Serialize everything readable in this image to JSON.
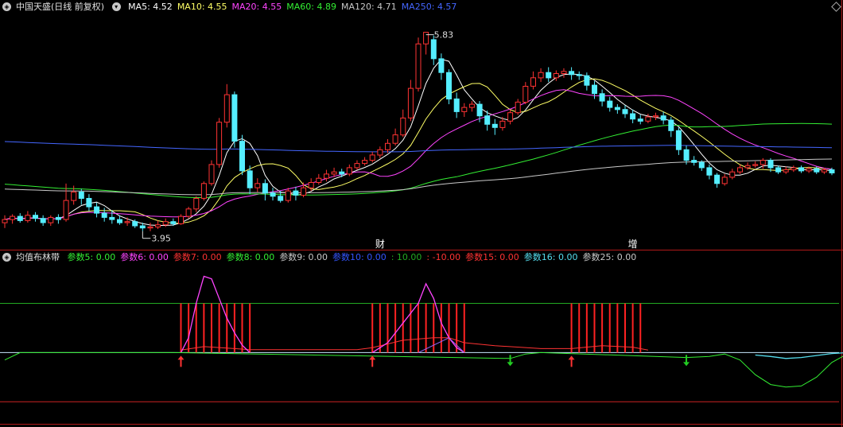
{
  "main_header": {
    "title": "中国天盛(日线 前复权)",
    "ma": [
      {
        "label": "MA5: 4.52",
        "color": "#ffffff"
      },
      {
        "label": "MA10: 4.55",
        "color": "#ffff66"
      },
      {
        "label": "MA20: 4.55",
        "color": "#ff44ff"
      },
      {
        "label": "MA60: 4.89",
        "color": "#33ee33"
      },
      {
        "label": "MA120: 4.71",
        "color": "#c8c8c8"
      },
      {
        "label": "MA250: 4.57",
        "color": "#4466ff"
      }
    ]
  },
  "sub_header": {
    "title": "均值布林带",
    "params": [
      {
        "label": "参数5: 0.00",
        "color": "#33ee33"
      },
      {
        "label": "参数6: 0.00",
        "color": "#ff44ff"
      },
      {
        "label": "参数7: 0.00",
        "color": "#ff3333"
      },
      {
        "label": "参数8: 0.00",
        "color": "#33ee33"
      },
      {
        "label": "参数9: 0.00",
        "color": "#c8c8c8"
      },
      {
        "label": "参数10: 0.00",
        "color": "#3355ff"
      },
      {
        "label": ": 10.00",
        "color": "#22aa22"
      },
      {
        "label": ": -10.00",
        "color": "#ff3333"
      },
      {
        "label": "参数15: 0.00",
        "color": "#ff3333"
      },
      {
        "label": "参数16: 0.00",
        "color": "#55ddee"
      },
      {
        "label": "参数25: 0.00",
        "color": "#c8c8c8"
      }
    ]
  },
  "markers": [
    {
      "text": "财",
      "color": "#ffffff"
    },
    {
      "text": "增",
      "color": "#ffffff"
    }
  ],
  "annotations": {
    "high": "5.83",
    "low": "3.95"
  },
  "colors": {
    "up": "#ff3333",
    "down": "#55eeff",
    "frame": "#b01818"
  },
  "chart_data": {
    "type": "candlestick",
    "ylim": [
      3.85,
      6.0
    ],
    "candles": [
      [
        4.03,
        4.06,
        3.98,
        4.1
      ],
      [
        4.06,
        4.09,
        4.02,
        4.11
      ],
      [
        4.09,
        4.05,
        4.03,
        4.12
      ],
      [
        4.05,
        4.1,
        4.03,
        4.14
      ],
      [
        4.1,
        4.07,
        4.04,
        4.13
      ],
      [
        4.07,
        4.03,
        4.0,
        4.1
      ],
      [
        4.03,
        4.08,
        4.0,
        4.1
      ],
      [
        4.08,
        4.06,
        4.02,
        4.11
      ],
      [
        4.06,
        4.24,
        4.04,
        4.4
      ],
      [
        4.24,
        4.32,
        4.2,
        4.38
      ],
      [
        4.32,
        4.26,
        4.2,
        4.35
      ],
      [
        4.26,
        4.18,
        4.14,
        4.3
      ],
      [
        4.18,
        4.12,
        4.08,
        4.22
      ],
      [
        4.12,
        4.08,
        4.04,
        4.17
      ],
      [
        4.08,
        4.06,
        4.02,
        4.15
      ],
      [
        4.06,
        4.03,
        4.01,
        4.1
      ],
      [
        4.03,
        4.04,
        4.0,
        4.08
      ],
      [
        4.04,
        4.0,
        3.98,
        4.06
      ],
      [
        4.0,
        3.98,
        3.95,
        4.03
      ],
      [
        3.98,
        3.99,
        3.95,
        4.03
      ],
      [
        3.99,
        4.01,
        3.97,
        4.05
      ],
      [
        4.01,
        4.04,
        3.99,
        4.07
      ],
      [
        4.04,
        4.02,
        4.0,
        4.07
      ],
      [
        4.02,
        4.09,
        4.01,
        4.11
      ],
      [
        4.09,
        4.16,
        4.07,
        4.18
      ],
      [
        4.16,
        4.26,
        4.13,
        4.28
      ],
      [
        4.26,
        4.4,
        4.24,
        4.42
      ],
      [
        4.4,
        4.58,
        4.38,
        4.62
      ],
      [
        4.58,
        4.98,
        4.55,
        5.02
      ],
      [
        4.98,
        5.24,
        4.93,
        5.34
      ],
      [
        5.24,
        4.8,
        4.74,
        5.27
      ],
      [
        4.8,
        4.52,
        4.48,
        4.86
      ],
      [
        4.52,
        4.36,
        4.3,
        4.57
      ],
      [
        4.36,
        4.4,
        4.32,
        4.45
      ],
      [
        4.4,
        4.31,
        4.24,
        4.44
      ],
      [
        4.31,
        4.28,
        4.24,
        4.36
      ],
      [
        4.28,
        4.24,
        4.22,
        4.33
      ],
      [
        4.24,
        4.33,
        4.22,
        4.36
      ],
      [
        4.33,
        4.29,
        4.24,
        4.37
      ],
      [
        4.29,
        4.36,
        4.27,
        4.41
      ],
      [
        4.36,
        4.41,
        4.33,
        4.45
      ],
      [
        4.41,
        4.45,
        4.39,
        4.49
      ],
      [
        4.45,
        4.49,
        4.42,
        4.53
      ],
      [
        4.49,
        4.51,
        4.46,
        4.55
      ],
      [
        4.51,
        4.49,
        4.46,
        4.54
      ],
      [
        4.49,
        4.55,
        4.47,
        4.58
      ],
      [
        4.55,
        4.59,
        4.53,
        4.62
      ],
      [
        4.59,
        4.62,
        4.57,
        4.65
      ],
      [
        4.62,
        4.67,
        4.6,
        4.7
      ],
      [
        4.67,
        4.72,
        4.64,
        4.75
      ],
      [
        4.72,
        4.78,
        4.69,
        4.82
      ],
      [
        4.78,
        4.86,
        4.76,
        4.92
      ],
      [
        4.86,
        5.02,
        4.84,
        5.1
      ],
      [
        5.02,
        5.3,
        4.99,
        5.38
      ],
      [
        5.3,
        5.72,
        5.27,
        5.78
      ],
      [
        5.72,
        5.83,
        5.62,
        5.83
      ],
      [
        5.76,
        5.58,
        5.52,
        5.8
      ],
      [
        5.58,
        5.45,
        5.38,
        5.63
      ],
      [
        5.45,
        5.2,
        5.15,
        5.48
      ],
      [
        5.2,
        5.08,
        5.02,
        5.26
      ],
      [
        5.08,
        5.12,
        5.03,
        5.16
      ],
      [
        5.12,
        5.15,
        5.08,
        5.18
      ],
      [
        5.15,
        5.04,
        4.98,
        5.18
      ],
      [
        5.04,
        4.96,
        4.9,
        5.09
      ],
      [
        4.96,
        4.93,
        4.86,
        5.01
      ],
      [
        4.93,
        4.99,
        4.9,
        5.03
      ],
      [
        4.99,
        5.07,
        4.96,
        5.1
      ],
      [
        5.07,
        5.17,
        5.05,
        5.2
      ],
      [
        5.17,
        5.32,
        5.15,
        5.36
      ],
      [
        5.32,
        5.4,
        5.29,
        5.46
      ],
      [
        5.4,
        5.45,
        5.36,
        5.49
      ],
      [
        5.45,
        5.4,
        5.36,
        5.5
      ],
      [
        5.4,
        5.44,
        5.37,
        5.47
      ],
      [
        5.44,
        5.46,
        5.4,
        5.49
      ],
      [
        5.46,
        5.43,
        5.38,
        5.5
      ],
      [
        5.43,
        5.42,
        5.38,
        5.46
      ],
      [
        5.42,
        5.33,
        5.28,
        5.45
      ],
      [
        5.33,
        5.25,
        5.2,
        5.37
      ],
      [
        5.25,
        5.18,
        5.13,
        5.29
      ],
      [
        5.18,
        5.12,
        5.08,
        5.22
      ],
      [
        5.12,
        5.1,
        5.06,
        5.15
      ],
      [
        5.1,
        5.06,
        5.02,
        5.14
      ],
      [
        5.06,
        5.01,
        4.97,
        5.1
      ],
      [
        5.01,
        4.99,
        4.96,
        5.05
      ],
      [
        4.99,
        5.03,
        4.97,
        5.06
      ],
      [
        5.03,
        5.04,
        5.0,
        5.07
      ],
      [
        5.04,
        5.0,
        4.96,
        5.08
      ],
      [
        5.0,
        4.9,
        4.84,
        5.03
      ],
      [
        4.9,
        4.72,
        4.67,
        4.93
      ],
      [
        4.72,
        4.62,
        4.58,
        4.76
      ],
      [
        4.62,
        4.6,
        4.57,
        4.66
      ],
      [
        4.6,
        4.55,
        4.52,
        4.62
      ],
      [
        4.55,
        4.48,
        4.44,
        4.58
      ],
      [
        4.48,
        4.4,
        4.36,
        4.5
      ],
      [
        4.4,
        4.46,
        4.38,
        4.49
      ],
      [
        4.46,
        4.51,
        4.44,
        4.54
      ],
      [
        4.51,
        4.55,
        4.49,
        4.58
      ],
      [
        4.55,
        4.57,
        4.53,
        4.6
      ],
      [
        4.57,
        4.58,
        4.55,
        4.61
      ],
      [
        4.58,
        4.62,
        4.54,
        4.64
      ],
      [
        4.62,
        4.55,
        4.51,
        4.64
      ],
      [
        4.55,
        4.51,
        4.49,
        4.57
      ],
      [
        4.51,
        4.53,
        4.49,
        4.56
      ],
      [
        4.53,
        4.55,
        4.51,
        4.57
      ],
      [
        4.55,
        4.52,
        4.5,
        4.57
      ],
      [
        4.52,
        4.54,
        4.5,
        4.56
      ],
      [
        4.54,
        4.51,
        4.49,
        4.56
      ],
      [
        4.51,
        4.53,
        4.49,
        4.55
      ],
      [
        4.53,
        4.5,
        4.48,
        4.55
      ]
    ],
    "ma": [
      {
        "name": "MA5",
        "color": "#ffffff",
        "period": 5
      },
      {
        "name": "MA10",
        "color": "#ffff66",
        "period": 10
      },
      {
        "name": "MA20",
        "color": "#ff44ff",
        "period": 20
      },
      {
        "name": "MA60",
        "color": "#33ee33",
        "period": 60
      },
      {
        "name": "MA120",
        "color": "#c8c8c8",
        "period": 120
      },
      {
        "name": "MA250",
        "color": "#4466ff",
        "period": 250
      }
    ],
    "indicator": {
      "ylim": [
        -14,
        18
      ],
      "upper": 10,
      "lower": -10,
      "bands": [
        [
          23,
          32
        ],
        [
          48,
          60
        ],
        [
          74,
          83
        ]
      ],
      "up_arrows": [
        23,
        48,
        74
      ],
      "down_arrows": [
        66,
        89
      ],
      "green_curve": [
        [
          0,
          -1.5
        ],
        [
          2,
          0
        ],
        [
          22,
          0
        ],
        [
          66,
          -1.2
        ],
        [
          68,
          -0.3
        ],
        [
          70,
          0
        ],
        [
          89,
          -1
        ],
        [
          92,
          -0.8
        ],
        [
          94,
          -0.3
        ],
        [
          96,
          -1.5
        ],
        [
          98,
          -4.5
        ],
        [
          100,
          -6.5
        ],
        [
          102,
          -7
        ],
        [
          104,
          -6.8
        ],
        [
          106,
          -5
        ],
        [
          108,
          -2
        ],
        [
          110,
          -0.3
        ],
        [
          112,
          0
        ]
      ],
      "cyan_curve": [
        [
          98,
          -0.5
        ],
        [
          100,
          -0.8
        ],
        [
          102,
          -1.2
        ],
        [
          104,
          -1.0
        ],
        [
          106,
          -0.6
        ],
        [
          108,
          -0.2
        ],
        [
          110,
          0
        ]
      ],
      "magenta_curve": [
        [
          23,
          0
        ],
        [
          24,
          3
        ],
        [
          25,
          10
        ],
        [
          26,
          15.5
        ],
        [
          27,
          15
        ],
        [
          28,
          11
        ],
        [
          29,
          7
        ],
        [
          30,
          4
        ],
        [
          31,
          1.5
        ],
        [
          32,
          0
        ]
      ],
      "magenta_curve2": [
        [
          48,
          0
        ],
        [
          50,
          2
        ],
        [
          52,
          6
        ],
        [
          54,
          10
        ],
        [
          55,
          14
        ],
        [
          56,
          11
        ],
        [
          57,
          6
        ],
        [
          58,
          3
        ],
        [
          59,
          1
        ],
        [
          60,
          0
        ]
      ],
      "red_curve": [
        [
          23,
          0.5
        ],
        [
          26,
          1.2
        ],
        [
          30,
          0.8
        ],
        [
          32,
          0.6
        ],
        [
          46,
          0.6
        ],
        [
          48,
          1
        ],
        [
          52,
          2.5
        ],
        [
          56,
          3
        ],
        [
          58,
          3
        ],
        [
          60,
          2
        ],
        [
          64,
          1.4
        ],
        [
          70,
          0.8
        ],
        [
          74,
          0.8
        ],
        [
          78,
          1.4
        ],
        [
          82,
          1.1
        ],
        [
          84,
          0.5
        ]
      ],
      "white_curve": [
        [
          54,
          0
        ],
        [
          56,
          1.5
        ],
        [
          58,
          3
        ],
        [
          60,
          0
        ]
      ]
    }
  }
}
